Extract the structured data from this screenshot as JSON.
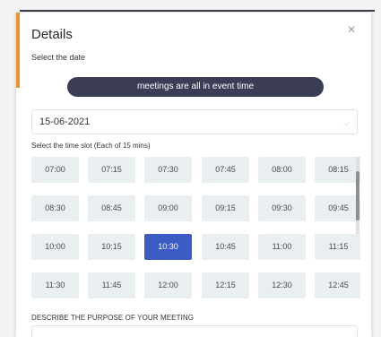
{
  "dialog": {
    "title": "Details",
    "close_glyph": "×",
    "date_label": "Select the date",
    "banner_text": "meetings are all in event time",
    "date_value": "15-06-2021",
    "date_chevron": "⌵",
    "slot_label": "Select the time slot (Each of 15 mins)",
    "purpose_label": "DESCRIBE THE PURPOSE OF YOUR MEETING"
  },
  "slots": [
    [
      "07:00",
      "07:15",
      "07:30",
      "07:45",
      "08:00",
      "08:15"
    ],
    [
      "08:30",
      "08:45",
      "09:00",
      "09:15",
      "09:30",
      "09:45"
    ],
    [
      "10:00",
      "10:15",
      "10:30",
      "10:45",
      "11:00",
      "11:15"
    ],
    [
      "11:30",
      "11:45",
      "12:00",
      "12:15",
      "12:30",
      "12:45"
    ]
  ],
  "selected_slot": "10:30",
  "colors": {
    "accent": "#f0932b",
    "banner": "#3a3d55",
    "selected": "#3d5bc4",
    "slot_bg": "#e9eef0"
  },
  "icons": {
    "close": "close-icon",
    "dropdown": "chevron-down-icon"
  }
}
